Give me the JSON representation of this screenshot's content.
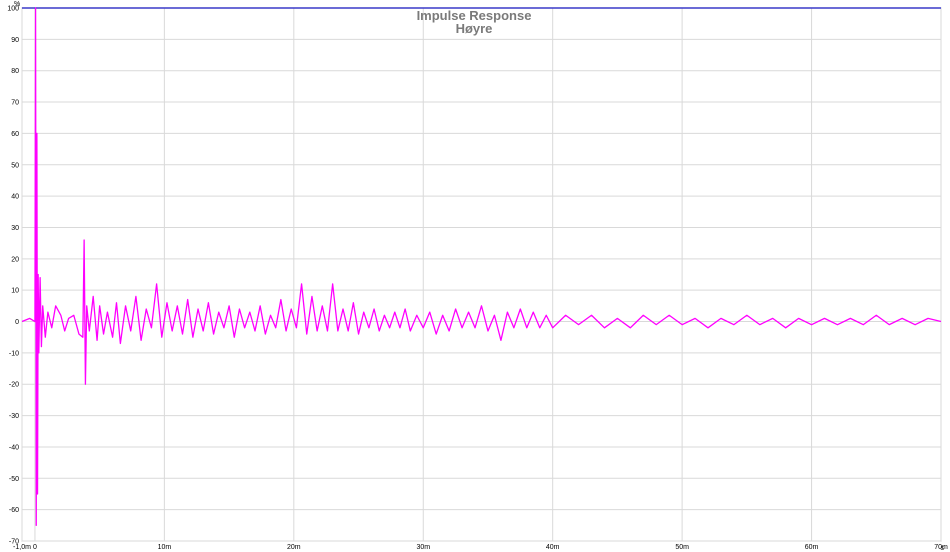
{
  "chart_data": {
    "type": "line",
    "title": "Impulse Response",
    "subtitle": "Høyre",
    "ylabel": "%",
    "xlabel": "s",
    "xlim": [
      -1.0,
      70.0
    ],
    "ylim": [
      -70,
      100
    ],
    "grid": true,
    "x_ticks": [
      {
        "value": -1.0,
        "label": "-1,0m"
      },
      {
        "value": 0,
        "label": "0"
      },
      {
        "value": 10,
        "label": "10m"
      },
      {
        "value": 20,
        "label": "20m"
      },
      {
        "value": 30,
        "label": "30m"
      },
      {
        "value": 40,
        "label": "40m"
      },
      {
        "value": 50,
        "label": "50m"
      },
      {
        "value": 60,
        "label": "60m"
      },
      {
        "value": 70,
        "label": "70m"
      }
    ],
    "y_ticks": [
      100,
      90,
      80,
      70,
      60,
      50,
      40,
      30,
      20,
      10,
      0,
      -10,
      -20,
      -30,
      -40,
      -50,
      -60,
      -70
    ],
    "reference_line": {
      "y": 100,
      "color": "#3a3ac8"
    },
    "series": [
      {
        "color": "#ff00ff",
        "x": [
          -1.0,
          -0.4,
          0,
          0.05,
          0.1,
          0.15,
          0.2,
          0.25,
          0.3,
          0.4,
          0.5,
          0.6,
          0.8,
          1.0,
          1.3,
          1.6,
          2.0,
          2.3,
          2.6,
          3.0,
          3.4,
          3.7,
          3.8,
          3.9,
          4.0,
          4.2,
          4.5,
          4.8,
          5.0,
          5.3,
          5.6,
          6.0,
          6.3,
          6.6,
          7.0,
          7.4,
          7.8,
          8.2,
          8.6,
          9.0,
          9.4,
          9.8,
          10.2,
          10.6,
          11.0,
          11.4,
          11.8,
          12.2,
          12.6,
          13.0,
          13.4,
          13.8,
          14.2,
          14.6,
          15.0,
          15.4,
          15.8,
          16.2,
          16.6,
          17.0,
          17.4,
          17.8,
          18.2,
          18.6,
          19.0,
          19.4,
          19.8,
          20.2,
          20.6,
          21.0,
          21.4,
          21.8,
          22.2,
          22.6,
          23.0,
          23.4,
          23.8,
          24.2,
          24.6,
          25.0,
          25.4,
          25.8,
          26.2,
          26.6,
          27.0,
          27.4,
          27.8,
          28.2,
          28.6,
          29.0,
          29.5,
          30.0,
          30.5,
          31.0,
          31.5,
          32.0,
          32.5,
          33.0,
          33.5,
          34.0,
          34.5,
          35.0,
          35.5,
          36.0,
          36.5,
          37.0,
          37.5,
          38.0,
          38.5,
          39.0,
          39.5,
          40.0,
          41.0,
          42.0,
          43.0,
          44.0,
          45.0,
          46.0,
          47.0,
          48.0,
          49.0,
          50.0,
          51.0,
          52.0,
          53.0,
          54.0,
          55.0,
          56.0,
          57.0,
          58.0,
          59.0,
          60.0,
          61.0,
          62.0,
          63.0,
          64.0,
          65.0,
          66.0,
          67.0,
          68.0,
          69.0,
          70.0
        ],
        "y": [
          0,
          1,
          0,
          100,
          -65,
          60,
          -55,
          15,
          -10,
          14,
          -8,
          5,
          -5,
          3,
          -2,
          5,
          2,
          -3,
          1,
          2,
          -4,
          -5,
          26,
          -20,
          5,
          -3,
          8,
          -6,
          5,
          -4,
          3,
          -5,
          6,
          -7,
          5,
          -3,
          8,
          -6,
          4,
          -2,
          12,
          -5,
          6,
          -3,
          5,
          -4,
          7,
          -5,
          4,
          -3,
          6,
          -4,
          3,
          -2,
          5,
          -5,
          4,
          -2,
          3,
          -3,
          5,
          -4,
          2,
          -2,
          7,
          -3,
          4,
          -2,
          12,
          -4,
          8,
          -3,
          5,
          -3,
          12,
          -3,
          4,
          -3,
          6,
          -4,
          3,
          -2,
          4,
          -3,
          2,
          -2,
          3,
          -2,
          4,
          -3,
          2,
          -2,
          3,
          -4,
          2,
          -3,
          4,
          -2,
          3,
          -2,
          5,
          -3,
          2,
          -6,
          3,
          -2,
          4,
          -2,
          3,
          -2,
          2,
          -2,
          2,
          -1,
          2,
          -2,
          1,
          -2,
          2,
          -1,
          2,
          -1,
          1,
          -2,
          1,
          -1,
          2,
          -1,
          1,
          -2,
          1,
          -1,
          1,
          -1,
          1,
          -1,
          2,
          -1,
          1,
          -1,
          1,
          0
        ]
      }
    ]
  }
}
